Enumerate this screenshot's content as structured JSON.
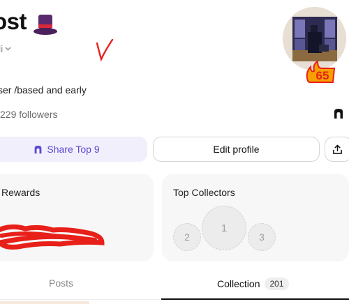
{
  "profile": {
    "title": "ost",
    "hat_icon": "top-hat-emoji",
    "username": "li",
    "chevron_icon": "chevron-down-icon",
    "handwritten_mark": "V",
    "bio": "ser /based and early",
    "followers": "229 followers",
    "arch_icon": "arch-icon",
    "avatar_badge": "65"
  },
  "actions": {
    "share_label": "Share Top 9",
    "edit_label": "Edit profile",
    "upload_icon": "upload-icon"
  },
  "cards": {
    "rewards_title": "Rewards",
    "collectors_title": "Top Collectors",
    "slots": [
      "1",
      "2",
      "3"
    ]
  },
  "tabs": {
    "posts_label": "Posts",
    "collection_label": "Collection",
    "collection_count": "201"
  },
  "colors": {
    "accent": "#5b4ad6",
    "share_bg": "#f1effb",
    "card_bg": "#f7f7f7",
    "scribble": "#e8201a",
    "badge": "#f5a000"
  }
}
